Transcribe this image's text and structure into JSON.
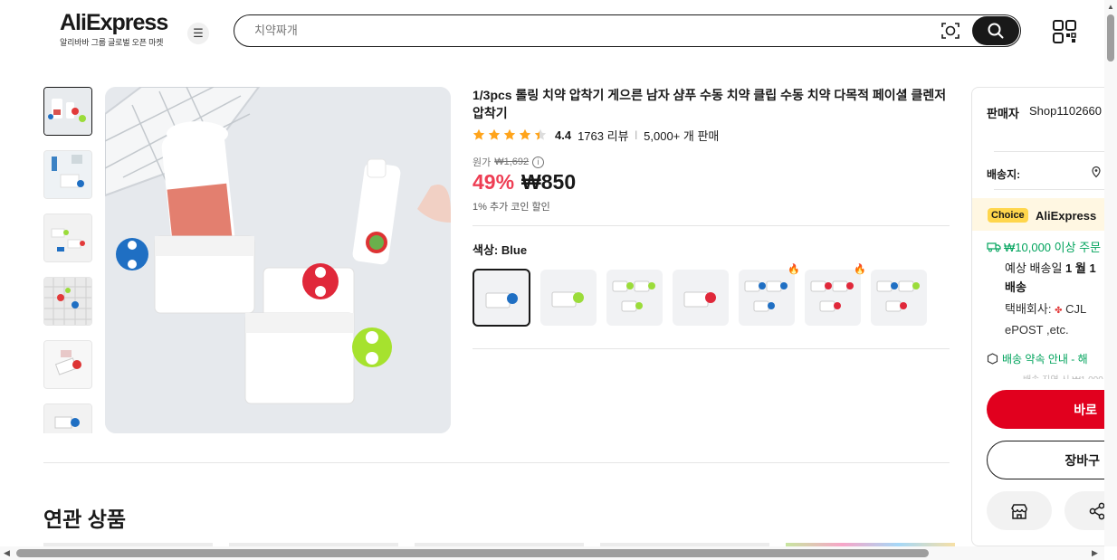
{
  "header": {
    "logo_text": "AliExpress",
    "logo_tagline": "알리바바 그룹 글로벌 오픈 마켓",
    "search_placeholder": "치약짜개"
  },
  "product": {
    "title": "1/3pcs 롤링 치약 압착기 게으른 남자 샴푸 수동 치약 클립 수동 치약 다목적 페이셜 클렌저 압착기",
    "rating": "4.4",
    "star_rating_value": 4.4,
    "reviews": "1763 리뷰",
    "sold": "5,000+ 개 판매",
    "orig_label": "원가",
    "orig_price": "₩1,692",
    "discount": "49%",
    "price": "₩850",
    "coin": "1% 추가 코인 할인",
    "color_label": "색상:",
    "color_value": "Blue",
    "swatches": [
      {
        "name": "Blue",
        "selected": true,
        "hot": false
      },
      {
        "name": "Green",
        "selected": false,
        "hot": false
      },
      {
        "name": "Green 3pcs",
        "selected": false,
        "hot": false
      },
      {
        "name": "Red",
        "selected": false,
        "hot": false
      },
      {
        "name": "Blue 3pcs",
        "selected": false,
        "hot": true
      },
      {
        "name": "Red 3pcs",
        "selected": false,
        "hot": true
      },
      {
        "name": "Mix 3pcs",
        "selected": false,
        "hot": false
      }
    ]
  },
  "related": {
    "heading": "연관 상품"
  },
  "side": {
    "seller_label": "판매자",
    "seller_name": "Shop1102660",
    "ship_label": "배송지:",
    "choice_badge": "Choice",
    "choice_text": "AliExpress",
    "free_ship": "₩10,000 이상 주문",
    "eta_label": "예상 배송일",
    "eta_value": "1 월 1",
    "eta_suffix": "배송",
    "carrier_label": "택배회사:",
    "carrier_value": "CJL",
    "carrier_value2": "ePOST ,etc.",
    "promise": "배송 약속 안내 - 해",
    "buy_label": "바로",
    "cart_label": "장바구"
  },
  "colors": {
    "accent_red": "#ee3e54",
    "buy_red": "#e1001e",
    "green": "#00a35c",
    "choice_yellow": "#ffd64c",
    "star": "#ffa41b"
  }
}
